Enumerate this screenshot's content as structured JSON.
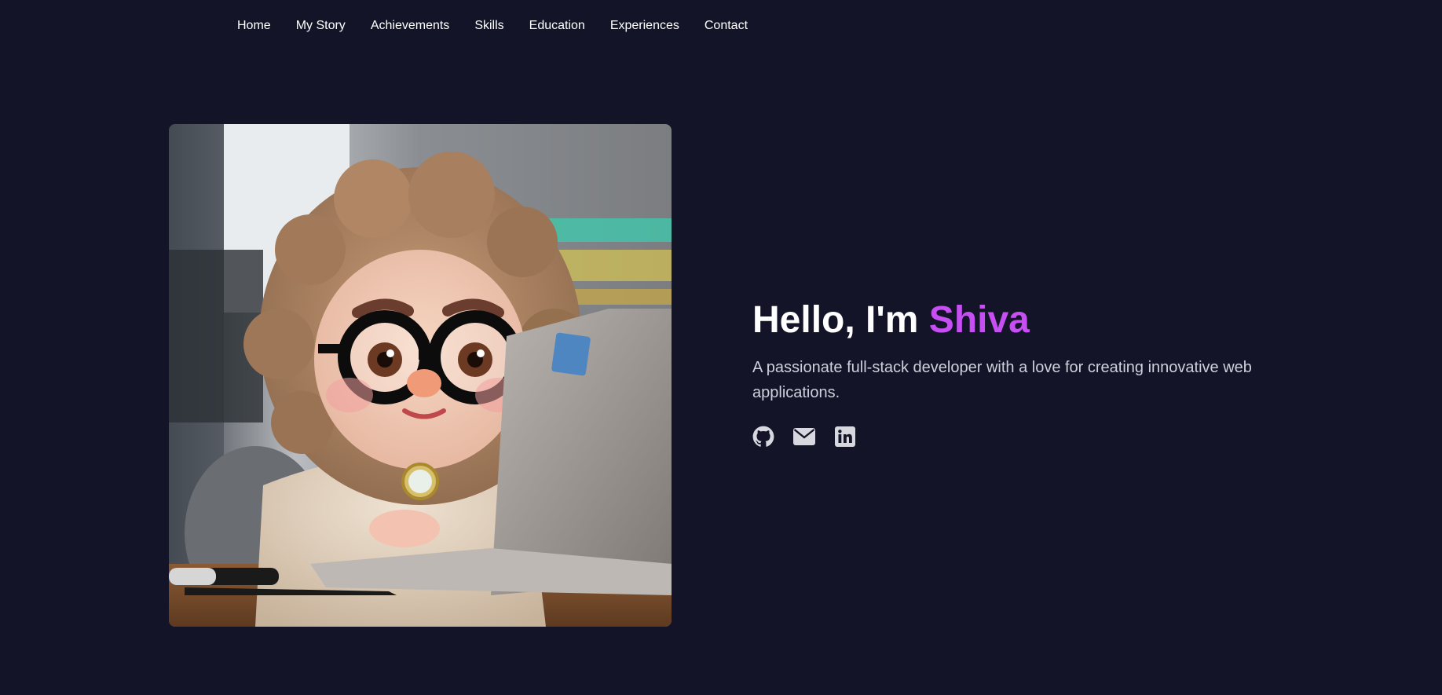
{
  "nav": {
    "items": [
      {
        "label": "Home"
      },
      {
        "label": "My Story"
      },
      {
        "label": "Achievements"
      },
      {
        "label": "Skills"
      },
      {
        "label": "Education"
      },
      {
        "label": "Experiences"
      },
      {
        "label": "Contact"
      }
    ]
  },
  "hero": {
    "greeting": "Hello, I'm ",
    "name": "Shiva",
    "subtitle": "A passionate full-stack developer with a love for creating innovative web applications.",
    "image_icon": "avatar-illustration",
    "socials": [
      {
        "icon": "github-icon"
      },
      {
        "icon": "email-icon"
      },
      {
        "icon": "linkedin-icon"
      }
    ]
  },
  "colors": {
    "background": "#131427",
    "accent": "#c64ff2",
    "text": "#ffffff",
    "muted": "#cfd0dc"
  }
}
